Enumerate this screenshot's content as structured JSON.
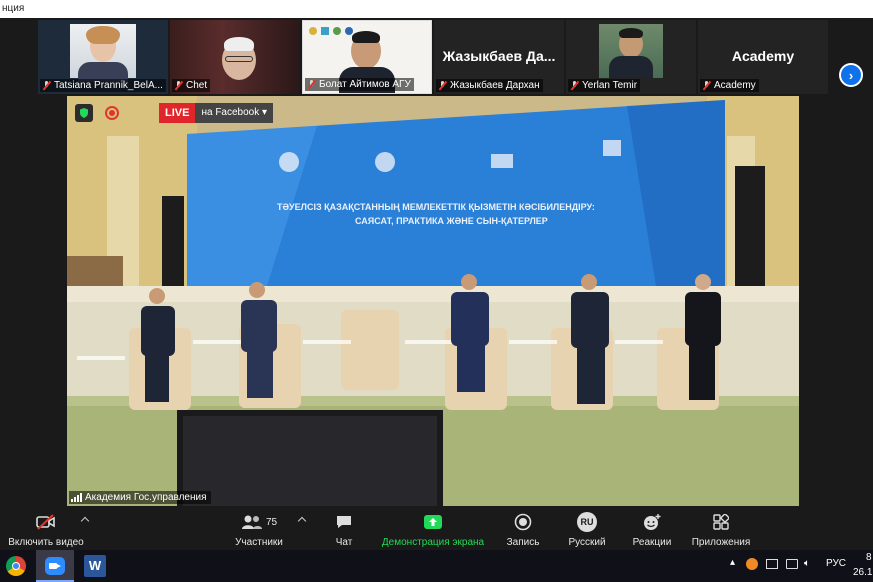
{
  "window": {
    "title": "нция"
  },
  "gallery": {
    "tiles": [
      {
        "name": "Tatsiana Prannik_BelA..."
      },
      {
        "name": "Chet"
      },
      {
        "name": "Болат Айтимов АГУ"
      },
      {
        "name": "Жазыкбаев Дархан",
        "display": "Жазыкбаев  Да..."
      },
      {
        "name": "Yerlan Temir"
      },
      {
        "name": "Academy",
        "display": "Academy"
      }
    ]
  },
  "main_video": {
    "live_label": "LIVE",
    "live_platform": "на Facebook",
    "participant_label": "Академия Гос.управления",
    "screen_title_line1": "ТӘУЕЛСІЗ ҚАЗАҚСТАННЫҢ МЕМЛЕКЕТТІК ҚЫЗМЕТІН КӘСІБИЛЕНДІРУ:",
    "screen_title_line2": "САЯСАТ, ПРАКТИКА ЖӘНЕ СЫН-ҚАТЕРЛЕР"
  },
  "toolbar": {
    "video_label": "Включить видео",
    "participants_label": "Участники",
    "participants_count": "75",
    "chat_label": "Чат",
    "share_label": "Демонстрация экрана",
    "record_label": "Запись",
    "language_label": "Русский",
    "language_code": "RU",
    "reactions_label": "Реакции",
    "apps_label": "Приложения"
  },
  "taskbar": {
    "language": "РУС",
    "time_partial": "8",
    "date_partial": "26.1"
  },
  "colors": {
    "accent_blue": "#0e72ed",
    "share_green": "#23d959",
    "live_red": "#e0262b"
  }
}
